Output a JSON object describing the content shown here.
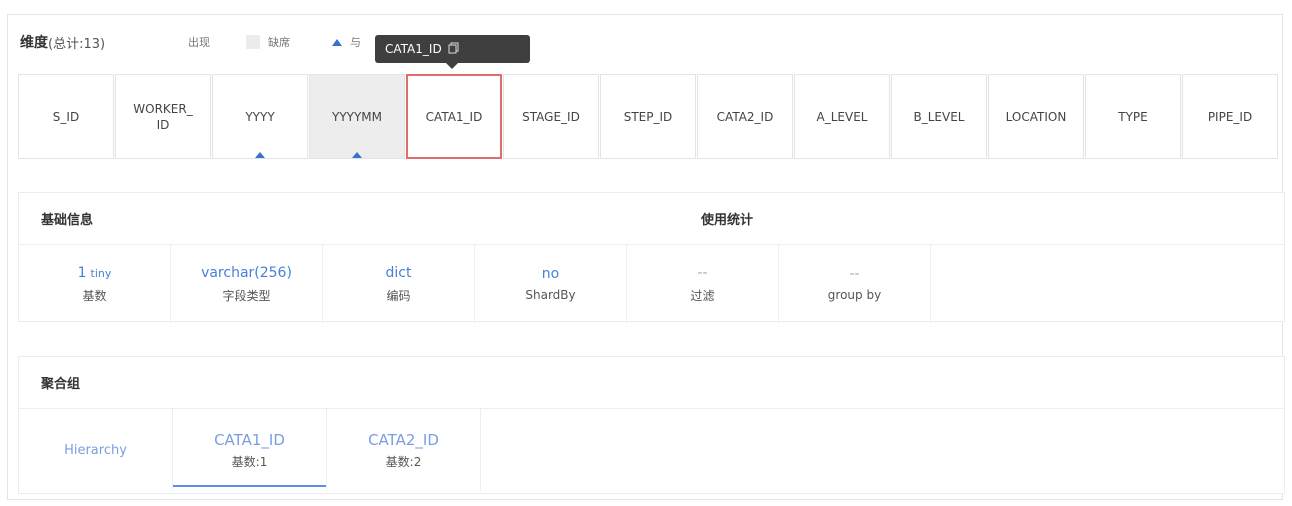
{
  "dimensions": {
    "title": "维度",
    "count_label": "(总计:13)",
    "legend": {
      "appear": "出现",
      "missing": "缺席",
      "related": "与"
    },
    "tooltip": {
      "text": "CATA1_ID",
      "icon": "copy-icon"
    },
    "columns": [
      {
        "label": "S_ID",
        "missing": false,
        "marked": false,
        "selected": false
      },
      {
        "label": "WORKER_ ID",
        "missing": false,
        "marked": false,
        "selected": false
      },
      {
        "label": "YYYY",
        "missing": false,
        "marked": true,
        "selected": false
      },
      {
        "label": "YYYYMM",
        "missing": true,
        "marked": true,
        "selected": false
      },
      {
        "label": "CATA1_ID",
        "missing": false,
        "marked": false,
        "selected": true
      },
      {
        "label": "STAGE_ID",
        "missing": false,
        "marked": false,
        "selected": false
      },
      {
        "label": "STEP_ID",
        "missing": false,
        "marked": false,
        "selected": false
      },
      {
        "label": "CATA2_ID",
        "missing": false,
        "marked": false,
        "selected": false
      },
      {
        "label": "A_LEVEL",
        "missing": false,
        "marked": false,
        "selected": false
      },
      {
        "label": "B_LEVEL",
        "missing": false,
        "marked": false,
        "selected": false
      },
      {
        "label": "LOCATION",
        "missing": false,
        "marked": false,
        "selected": false
      },
      {
        "label": "TYPE",
        "missing": false,
        "marked": false,
        "selected": false
      },
      {
        "label": "PIPE_ID",
        "missing": false,
        "marked": false,
        "selected": false
      }
    ]
  },
  "basic_info": {
    "title": "基础信息",
    "usage_title": "使用统计",
    "cells": [
      {
        "value": "1",
        "suffix": "tiny",
        "label": "基数"
      },
      {
        "value": "varchar(256)",
        "suffix": "",
        "label": "字段类型"
      },
      {
        "value": "dict",
        "suffix": "",
        "label": "编码"
      },
      {
        "value": "no",
        "suffix": "",
        "label": "ShardBy"
      },
      {
        "value": "--",
        "suffix": "",
        "label": "过滤"
      },
      {
        "value": "--",
        "suffix": "",
        "label": "group by"
      }
    ]
  },
  "aggregation": {
    "title": "聚合组",
    "hierarchy_label": "Hierarchy",
    "groups": [
      {
        "value": "CATA1_ID",
        "label": "基数:1",
        "active": true
      },
      {
        "value": "CATA2_ID",
        "label": "基数:2",
        "active": false
      }
    ]
  },
  "colors": {
    "accent": "#4a7fd8",
    "selected_border": "#e26c6c",
    "missing_bg": "#ededed",
    "tooltip_bg": "#3f3f3f"
  }
}
